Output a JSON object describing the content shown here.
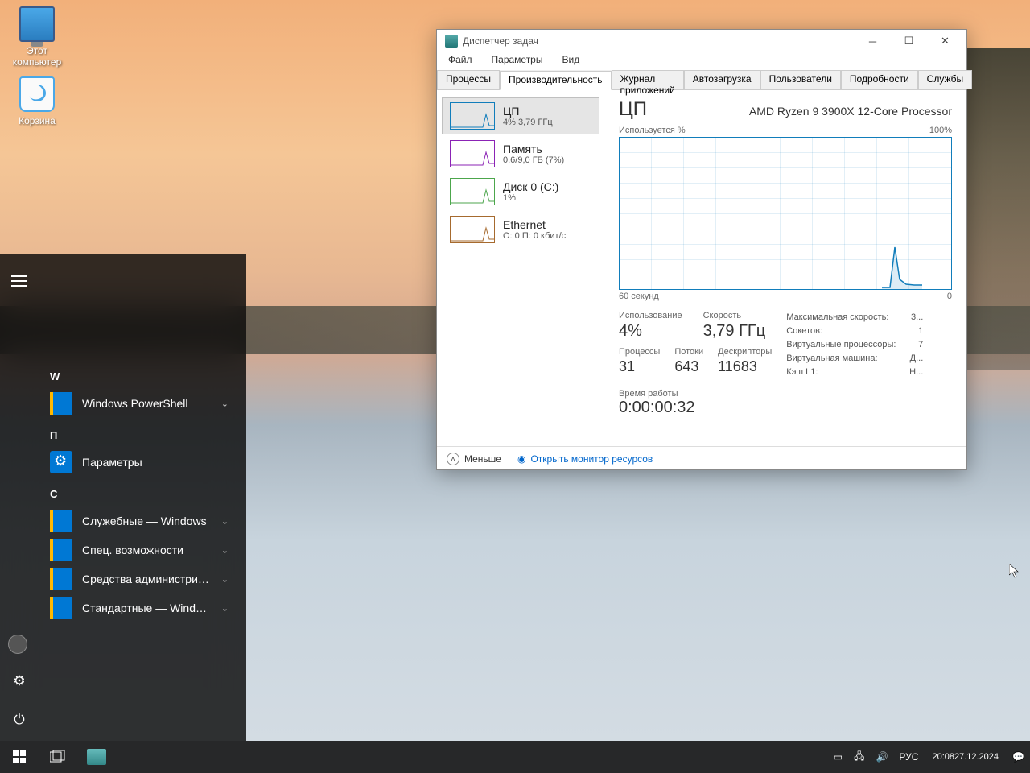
{
  "desktop_icons": {
    "pc": "Этот\nкомпьютер",
    "bin": "Корзина"
  },
  "startmenu": {
    "groups": [
      {
        "letter": "W",
        "items": [
          {
            "label": "Windows PowerShell",
            "expandable": true,
            "icon": "folder"
          }
        ]
      },
      {
        "letter": "П",
        "items": [
          {
            "label": "Параметры",
            "expandable": false,
            "icon": "gear"
          }
        ]
      },
      {
        "letter": "С",
        "items": [
          {
            "label": "Служебные — Windows",
            "expandable": true,
            "icon": "folder"
          },
          {
            "label": "Спец. возможности",
            "expandable": true,
            "icon": "folder"
          },
          {
            "label": "Средства администрировани...",
            "expandable": true,
            "icon": "folder"
          },
          {
            "label": "Стандартные — Windows",
            "expandable": true,
            "icon": "folder"
          }
        ]
      }
    ]
  },
  "taskmgr": {
    "title": "Диспетчер задач",
    "menu": [
      "Файл",
      "Параметры",
      "Вид"
    ],
    "tabs": [
      "Процессы",
      "Производительность",
      "Журнал приложений",
      "Автозагрузка",
      "Пользователи",
      "Подробности",
      "Службы"
    ],
    "active_tab": 1,
    "resources": [
      {
        "name": "ЦП",
        "sub": "4% 3,79 ГГц",
        "color": "#117dbb"
      },
      {
        "name": "Память",
        "sub": "0,6/9,0 ГБ (7%)",
        "color": "#8b23b5"
      },
      {
        "name": "Диск 0 (C:)",
        "sub": "1%",
        "color": "#4ca64c"
      },
      {
        "name": "Ethernet",
        "sub": "О: 0 П: 0 кбит/с",
        "color": "#a66a2e"
      }
    ],
    "main": {
      "title": "ЦП",
      "model": "AMD Ryzen 9 3900X 12-Core Processor",
      "chart_top_left": "Используется %",
      "chart_top_right": "100%",
      "chart_bot_left": "60 секунд",
      "chart_bot_right": "0",
      "stats_row1": [
        {
          "lbl": "Использование",
          "val": "4%"
        },
        {
          "lbl": "Скорость",
          "val": "3,79 ГГц"
        }
      ],
      "stats_row2": [
        {
          "lbl": "Процессы",
          "val": "31"
        },
        {
          "lbl": "Потоки",
          "val": "643"
        },
        {
          "lbl": "Дескрипторы",
          "val": "11683"
        }
      ],
      "right_stats": [
        {
          "k": "Максимальная скорость:",
          "v": "3..."
        },
        {
          "k": "Сокетов:",
          "v": "1"
        },
        {
          "k": "Виртуальные процессоры:",
          "v": "7"
        },
        {
          "k": "Виртуальная машина:",
          "v": "Д..."
        },
        {
          "k": "Кэш L1:",
          "v": "Н..."
        }
      ],
      "uptime": {
        "lbl": "Время работы",
        "val": "0:00:00:32"
      }
    },
    "footer": {
      "less": "Меньше",
      "resmon": "Открыть монитор ресурсов"
    }
  },
  "taskbar": {
    "lang": "РУС",
    "time": "20:08",
    "date": "27.12.2024"
  },
  "chart_data": {
    "type": "line",
    "title": "ЦП — Используется %",
    "x_label": "60 секунд",
    "y_label": "%",
    "ylim": [
      0,
      100
    ],
    "x": [
      0,
      5,
      10,
      15,
      20,
      25,
      30,
      35,
      40,
      45,
      50,
      53,
      54,
      55,
      56,
      57,
      58,
      59,
      60
    ],
    "values": [
      1,
      1,
      1,
      1,
      1,
      1,
      1,
      1,
      1,
      1,
      1,
      2,
      30,
      8,
      4,
      3,
      4,
      4,
      4
    ]
  }
}
